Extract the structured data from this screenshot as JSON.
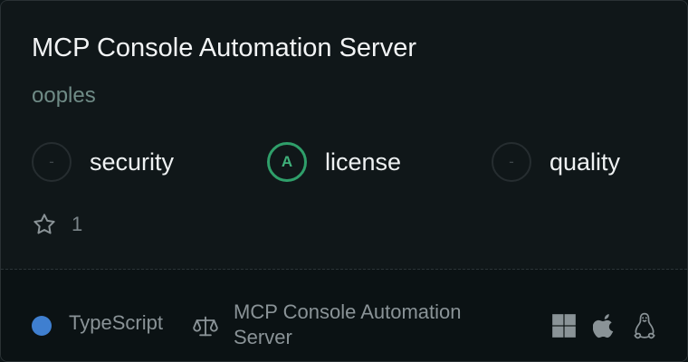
{
  "card": {
    "title": "MCP Console Automation Server",
    "author": "ooples",
    "badges": [
      {
        "grade": "-",
        "label": "security",
        "graded": false
      },
      {
        "grade": "A",
        "label": "license",
        "graded": true
      },
      {
        "grade": "-",
        "label": "quality",
        "graded": false
      }
    ],
    "stars": "1",
    "language": "TypeScript",
    "language_color": "#3f7fd0",
    "license_name": "MCP Console Automation Server",
    "platform_icons": [
      "windows-icon",
      "apple-icon",
      "linux-icon"
    ]
  }
}
